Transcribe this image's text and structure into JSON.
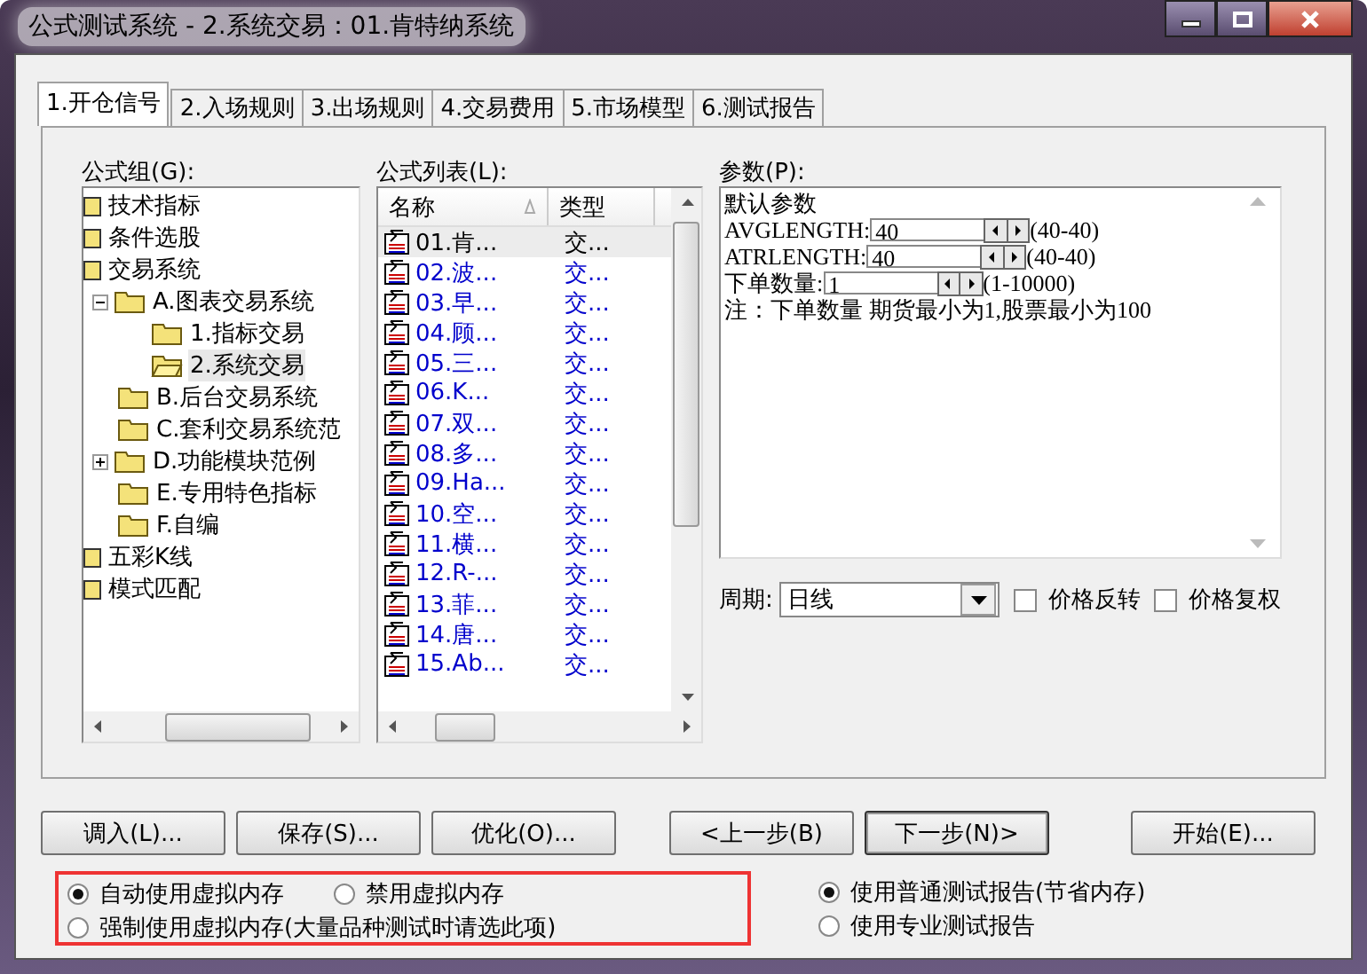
{
  "window": {
    "title": "公式测试系统 - 2.系统交易：01.肯特纳系统"
  },
  "tabs": [
    {
      "label": "1.开仓信号",
      "selected": true
    },
    {
      "label": "2.入场规则",
      "selected": false
    },
    {
      "label": "3.出场规则",
      "selected": false
    },
    {
      "label": "4.交易费用",
      "selected": false
    },
    {
      "label": "5.市场模型",
      "selected": false
    },
    {
      "label": "6.测试报告",
      "selected": false
    }
  ],
  "formula_groups": {
    "label": "公式组(G):",
    "items": [
      {
        "label": "技术指标",
        "kind": "group",
        "selected": false
      },
      {
        "label": "条件选股",
        "kind": "group",
        "selected": false
      },
      {
        "label": "交易系统",
        "kind": "group",
        "selected": false,
        "children": [
          {
            "label": "A.图表交易系统",
            "kind": "folder",
            "expanded": true,
            "selected": false,
            "children": [
              {
                "label": "1.指标交易",
                "kind": "folder",
                "selected": false
              },
              {
                "label": "2.系统交易",
                "kind": "open-folder",
                "selected": true
              }
            ]
          },
          {
            "label": "B.后台交易系统",
            "kind": "folder",
            "selected": false
          },
          {
            "label": "C.套利交易系统范",
            "kind": "folder",
            "selected": false
          },
          {
            "label": "D.功能模块范例",
            "kind": "folder",
            "expanded": false,
            "selected": false
          },
          {
            "label": "E.专用特色指标",
            "kind": "folder",
            "selected": false
          },
          {
            "label": "F.自编",
            "kind": "folder",
            "selected": false
          }
        ]
      },
      {
        "label": "五彩K线",
        "kind": "group",
        "selected": false
      },
      {
        "label": "模式匹配",
        "kind": "group",
        "selected": false
      }
    ]
  },
  "formula_list": {
    "label": "公式列表(L):",
    "columns": [
      "名称",
      "类型"
    ],
    "rows": [
      {
        "name": "01.肯...",
        "type": "交...",
        "selected": true
      },
      {
        "name": "02.波...",
        "type": "交...",
        "selected": false
      },
      {
        "name": "03.早...",
        "type": "交...",
        "selected": false
      },
      {
        "name": "04.顾...",
        "type": "交...",
        "selected": false
      },
      {
        "name": "05.三...",
        "type": "交...",
        "selected": false
      },
      {
        "name": "06.K...",
        "type": "交...",
        "selected": false
      },
      {
        "name": "07.双...",
        "type": "交...",
        "selected": false
      },
      {
        "name": "08.多...",
        "type": "交...",
        "selected": false
      },
      {
        "name": "09.Ha...",
        "type": "交...",
        "selected": false
      },
      {
        "name": "10.空...",
        "type": "交...",
        "selected": false
      },
      {
        "name": "11.横...",
        "type": "交...",
        "selected": false
      },
      {
        "name": "12.R-...",
        "type": "交...",
        "selected": false
      },
      {
        "name": "13.菲...",
        "type": "交...",
        "selected": false
      },
      {
        "name": "14.唐...",
        "type": "交...",
        "selected": false
      },
      {
        "name": "15.Ab...",
        "type": "交...",
        "selected": false
      }
    ]
  },
  "parameters": {
    "label": "参数(P):",
    "heading": "默认参数",
    "fields": [
      {
        "name": "AVGLENGTH:",
        "value": "40",
        "range": "(40-40)"
      },
      {
        "name": "ATRLENGTH:",
        "value": "40",
        "range": "(40-40)"
      },
      {
        "name": "下单数量:",
        "value": "1",
        "range": "(1-10000)"
      }
    ],
    "note": "注：下单数量 期货最小为1,股票最小为100"
  },
  "period": {
    "label": "周期:",
    "value": "日线"
  },
  "options": [
    {
      "label": "价格反转",
      "checked": false
    },
    {
      "label": "价格复权",
      "checked": false
    }
  ],
  "button_groups": [
    [
      {
        "label": "调入(L)...",
        "default": false
      },
      {
        "label": "保存(S)...",
        "default": false
      },
      {
        "label": "优化(O)...",
        "default": false
      }
    ],
    [
      {
        "label": "<上一步(B)",
        "default": false
      },
      {
        "label": "下一步(N)>",
        "default": true
      }
    ],
    [
      {
        "label": "开始(E)...",
        "default": false
      }
    ]
  ],
  "memory_options": [
    {
      "label": "自动使用虚拟内存",
      "selected": true
    },
    {
      "label": "禁用虚拟内存",
      "selected": false
    },
    {
      "label": "强制使用虚拟内存(大量品种测试时请选此项)",
      "selected": false
    }
  ],
  "report_options": [
    {
      "label": "使用普通测试报告(节省内存)",
      "selected": true
    },
    {
      "label": "使用专业测试报告",
      "selected": false
    }
  ]
}
